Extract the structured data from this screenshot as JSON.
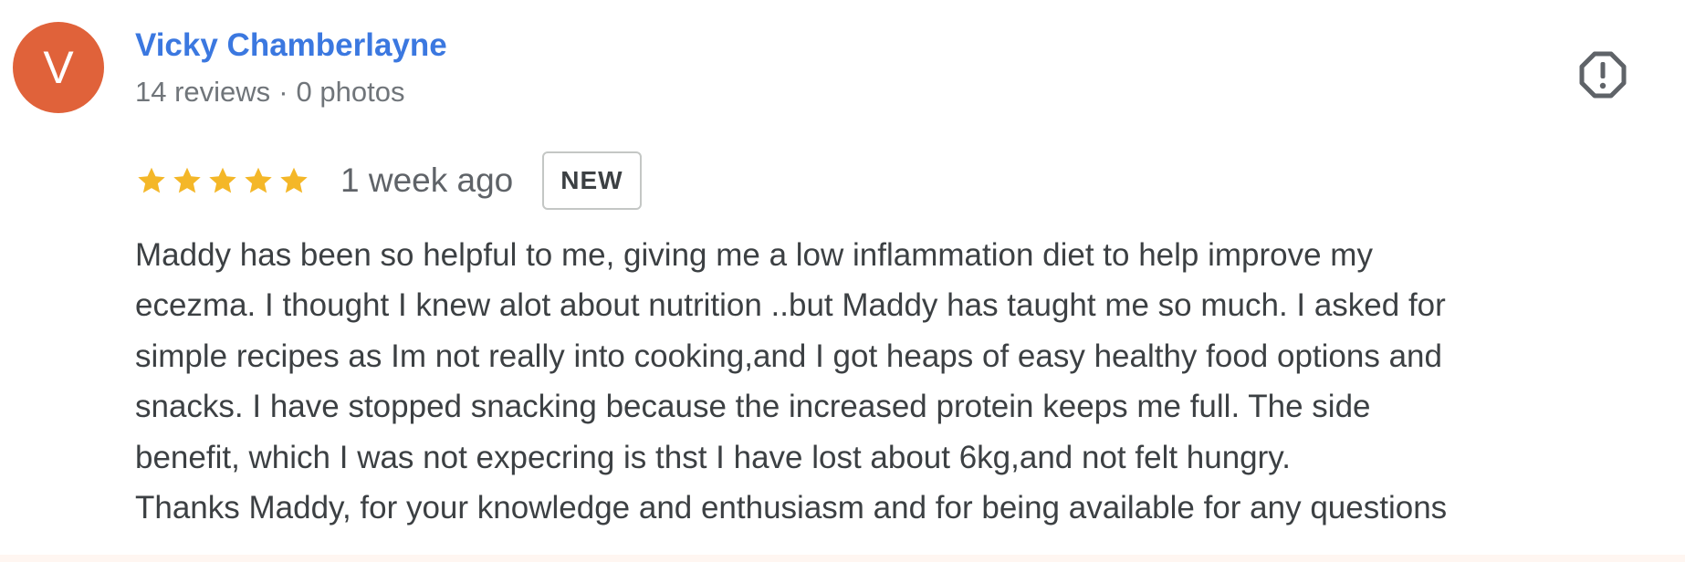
{
  "reviewer": {
    "avatar_initial": "V",
    "avatar_color": "#e0623a",
    "name": "Vicky Chamberlayne",
    "reviews_count": "14 reviews",
    "separator": "·",
    "photos_count": "0 photos"
  },
  "report_button": {
    "icon": "report-flag-icon"
  },
  "rating": {
    "stars": 5,
    "max_stars": 5,
    "star_color": "#f4b728",
    "date": "1 week ago",
    "badge": "NEW"
  },
  "review": {
    "lines": [
      "Maddy has been so helpful to me, giving me a low inflammation diet to help improve my",
      "ecezma. I thought I knew alot about nutrition ..but Maddy has taught me so much. I asked for",
      "simple recipes as Im not really into cooking,and I got heaps of easy healthy food options and",
      "snacks. I have stopped snacking because the increased protein keeps me full. The side",
      "benefit, which I was not expecring is thst I have lost about 6kg,and not felt hungry.",
      "Thanks Maddy, for your knowledge and enthusiasm and for being available for any questions"
    ]
  }
}
